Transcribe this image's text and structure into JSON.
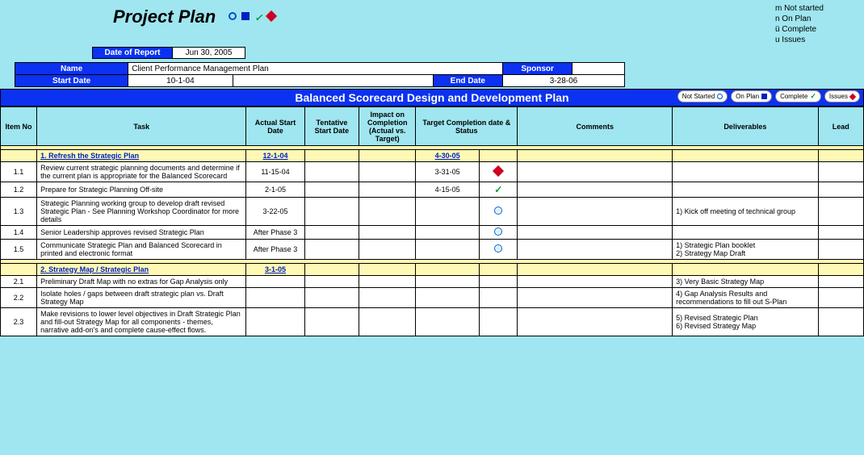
{
  "title": "Project Plan",
  "legend_top": {
    "l1": "m Not started",
    "l2": "n On Plan",
    "l3": "ü Complete",
    "l4": "u Issues"
  },
  "date_of_report": {
    "label": "Date of Report",
    "value": "Jun 30, 2005"
  },
  "info": {
    "name_label": "Name",
    "name_value": "Client Performance Management Plan",
    "sponsor_label": "Sponsor",
    "sponsor_value": "",
    "start_label": "Start Date",
    "start_value": "10-1-04",
    "end_label": "End Date",
    "end_value": "3-28-06"
  },
  "section_title": "Balanced Scorecard Design and Development Plan",
  "legend_buttons": {
    "b1": "Not Started",
    "b2": "On Plan",
    "b3": "Complete",
    "b4": "Issues"
  },
  "columns": {
    "item": "Item No",
    "task": "Task",
    "astart": "Actual Start Date",
    "tstart": "Tentative Start Date",
    "impact": "Impact on Completion (Actual vs. Target)",
    "target": "Target Completion date & Status",
    "comments": "Comments",
    "deliver": "Deliverables",
    "lead": "Lead"
  },
  "sections": [
    {
      "heading": "1. Refresh the Strategic Plan",
      "astart": "12-1-04",
      "target": "4-30-05",
      "rows": [
        {
          "item": "1.1",
          "task": "Review current strategic planning documents and determine if the current plan is appropriate for the Balanced Scorecard",
          "astart": "11-15-04",
          "target": "3-31-05",
          "status": "diamond",
          "deliver": ""
        },
        {
          "item": "1.2",
          "task": "Prepare for Strategic Planning Off-site",
          "astart": "2-1-05",
          "target": "4-15-05",
          "status": "check",
          "deliver": ""
        },
        {
          "item": "1.3",
          "task": "Strategic Planning working group to develop draft revised Strategic Plan - See Planning Workshop Coordinator for more details",
          "astart": "3-22-05",
          "target": "",
          "status": "circle",
          "deliver": "1) Kick off meeting of technical group"
        },
        {
          "item": "1.4",
          "task": "Senior Leadership approves revised Strategic Plan",
          "astart": "After Phase 3",
          "target": "",
          "status": "circle",
          "deliver": ""
        },
        {
          "item": "1.5",
          "task": "Communicate Strategic Plan and Balanced Scorecard in printed and electronic format",
          "astart": "After Phase 3",
          "target": "",
          "status": "circle",
          "deliver": "1) Strategic Plan booklet\n2) Strategy Map Draft"
        }
      ]
    },
    {
      "heading": "2. Strategy Map / Strategic Plan",
      "astart": "3-1-05",
      "target": "",
      "rows": [
        {
          "item": "2.1",
          "task": "Preliminary Draft Map with no extras for Gap Analysis only",
          "astart": "",
          "target": "",
          "status": "",
          "deliver": "3) Very Basic Strategy Map"
        },
        {
          "item": "2.2",
          "task": "Isolate holes / gaps between draft strategic plan vs. Draft Strategy Map",
          "astart": "",
          "target": "",
          "status": "",
          "deliver": "4) Gap Analysis Results and recommendations to fill out S-Plan"
        },
        {
          "item": "2.3",
          "task": "Make revisions to lower level objectives in Draft Strategic Plan and fill-out Strategy Map for all components - themes, narrative add-on's and complete cause-effect flows.",
          "astart": "",
          "target": "",
          "status": "",
          "deliver": "5) Revised Strategic Plan\n6) Revised Strategy Map"
        }
      ]
    }
  ]
}
